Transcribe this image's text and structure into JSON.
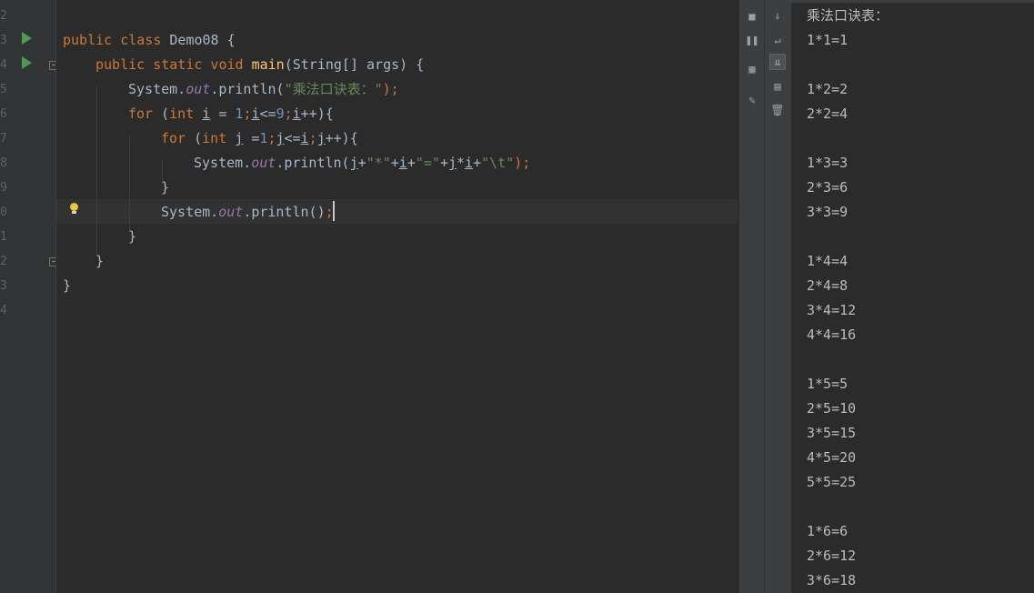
{
  "editor": {
    "line_numbers": [
      "2",
      "3",
      "4",
      "5",
      "6",
      "7",
      "8",
      "9",
      "0",
      "1",
      "2",
      "3",
      "4"
    ],
    "lines": [
      [],
      [
        [
          "kw",
          "public class "
        ],
        [
          "pl",
          "Demo08 {"
        ]
      ],
      [
        [
          "kw",
          "public static void "
        ],
        [
          "fn",
          "main"
        ],
        [
          "pl",
          "(String[] args) {"
        ]
      ],
      [
        [
          "pl",
          "System."
        ],
        [
          "it",
          "out"
        ],
        [
          "pl",
          ".println("
        ],
        [
          "st",
          "\"乘法口诀表：\""
        ],
        [
          "kw",
          ");"
        ]
      ],
      [
        [
          "kw",
          "for "
        ],
        [
          "pl",
          "("
        ],
        [
          "kw",
          "int "
        ],
        [
          "pl ul",
          "i"
        ],
        [
          "pl",
          " = "
        ],
        [
          "nu",
          "1"
        ],
        [
          "kw",
          ";"
        ],
        [
          "pl ul",
          "i"
        ],
        [
          "pl",
          "<="
        ],
        [
          "nu",
          "9"
        ],
        [
          "kw",
          ";"
        ],
        [
          "pl ul",
          "i"
        ],
        [
          "pl",
          "++){"
        ]
      ],
      [
        [
          "kw",
          "for "
        ],
        [
          "pl",
          "("
        ],
        [
          "kw",
          "int "
        ],
        [
          "pl ul",
          "j"
        ],
        [
          "pl",
          " ="
        ],
        [
          "nu",
          "1"
        ],
        [
          "kw",
          ";"
        ],
        [
          "pl ul",
          "j"
        ],
        [
          "pl",
          "<="
        ],
        [
          "pl ul",
          "i"
        ],
        [
          "kw",
          ";"
        ],
        [
          "pl ul",
          "j"
        ],
        [
          "pl",
          "++){"
        ]
      ],
      [
        [
          "pl",
          "System."
        ],
        [
          "it",
          "out"
        ],
        [
          "pl",
          ".println("
        ],
        [
          "pl ul",
          "j"
        ],
        [
          "pl",
          "+"
        ],
        [
          "st",
          "\"*\""
        ],
        [
          "pl",
          "+"
        ],
        [
          "pl ul",
          "i"
        ],
        [
          "pl",
          "+"
        ],
        [
          "st",
          "\"=\""
        ],
        [
          "pl",
          "+"
        ],
        [
          "pl ul",
          "j"
        ],
        [
          "pl",
          "*"
        ],
        [
          "pl ul",
          "i"
        ],
        [
          "pl",
          "+"
        ],
        [
          "st",
          "\"\\t\""
        ],
        [
          "kw",
          ");"
        ]
      ],
      [
        [
          "pl",
          "}"
        ]
      ],
      [
        [
          "pl",
          "System."
        ],
        [
          "it",
          "out"
        ],
        [
          "pl",
          ".println()"
        ],
        [
          "kw",
          ";"
        ]
      ],
      [
        [
          "pl",
          "}"
        ]
      ],
      [
        [
          "pl",
          "}"
        ]
      ],
      [
        [
          "pl",
          "}"
        ]
      ],
      []
    ]
  },
  "console": {
    "lines": [
      "乘法口诀表：",
      "1*1=1",
      "",
      "1*2=2",
      "2*2=4",
      "",
      "1*3=3",
      "2*3=6",
      "3*3=9",
      "",
      "1*4=4",
      "2*4=8",
      "3*4=12",
      "4*4=16",
      "",
      "1*5=5",
      "2*5=10",
      "3*5=15",
      "4*5=20",
      "5*5=25",
      "",
      "1*6=6",
      "2*6=12",
      "3*6=18"
    ]
  },
  "toolbar": {
    "left_icons": [
      "stop-icon",
      "pause-icon",
      "layout-icon",
      "pin-icon"
    ],
    "right_icons": [
      "down-arrow-icon",
      "soft-wrap-icon",
      "scroll-to-end-icon",
      "print-icon",
      "trash-icon"
    ]
  },
  "colors": {
    "keyword": "#cc7832",
    "function": "#ffc66d",
    "string": "#6a8759",
    "number": "#6897bb",
    "field": "#9876aa",
    "text": "#a9b7c6",
    "run": "#499c54"
  }
}
